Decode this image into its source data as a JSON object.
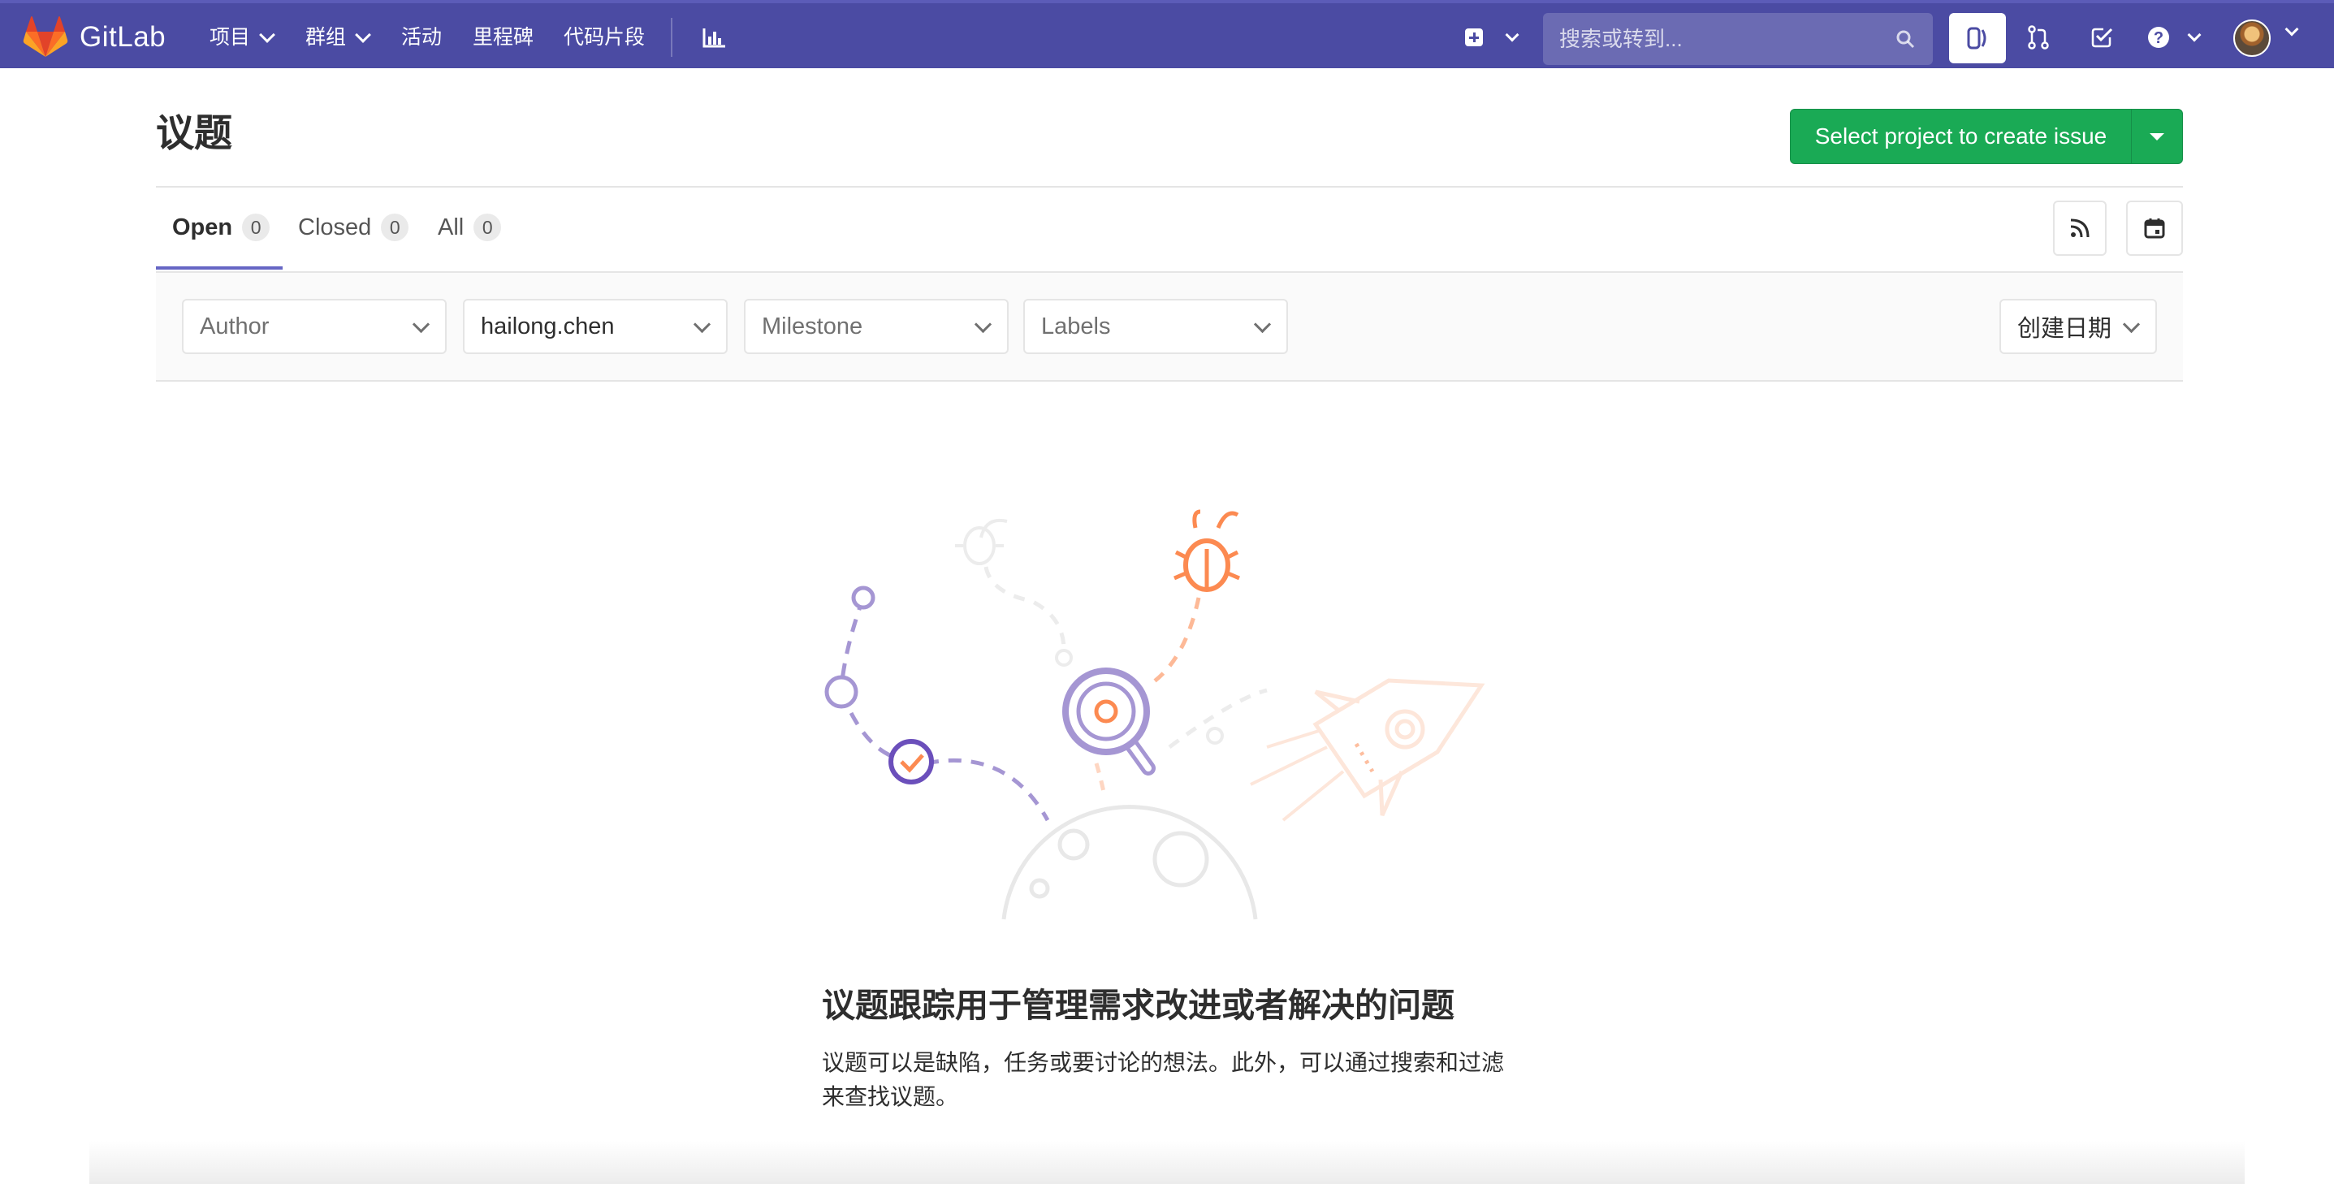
{
  "navbar": {
    "brand": "GitLab",
    "menu": [
      {
        "label": "项目",
        "has_dropdown": true
      },
      {
        "label": "群组",
        "has_dropdown": true
      },
      {
        "label": "活动",
        "has_dropdown": false
      },
      {
        "label": "里程碑",
        "has_dropdown": false
      },
      {
        "label": "代码片段",
        "has_dropdown": false
      }
    ],
    "search_placeholder": "搜索或转到...",
    "icons": [
      "chart-icon",
      "plus-square-icon",
      "issues-icon",
      "merge-request-icon",
      "todo-check-icon",
      "help-icon",
      "avatar"
    ]
  },
  "page": {
    "title": "议题",
    "create_button_label": "Select project to create issue"
  },
  "tabs": [
    {
      "label": "Open",
      "count": "0",
      "active": true
    },
    {
      "label": "Closed",
      "count": "0",
      "active": false
    },
    {
      "label": "All",
      "count": "0",
      "active": false
    }
  ],
  "filters": {
    "author": "Author",
    "assignee": "hailong.chen",
    "milestone": "Milestone",
    "labels": "Labels",
    "sort": "创建日期"
  },
  "empty_state": {
    "title": "议题跟踪用于管理需求改进或者解决的问题",
    "description": "议题可以是缺陷，任务或要讨论的想法。此外，可以通过搜索和过滤来查找议题。"
  },
  "colors": {
    "navbar": "#4b4ba3",
    "primary_button": "#1aaa55",
    "tab_active": "#6666c4",
    "illustration_purple": "#6b4fbb",
    "illustration_orange": "#fc8a51"
  }
}
